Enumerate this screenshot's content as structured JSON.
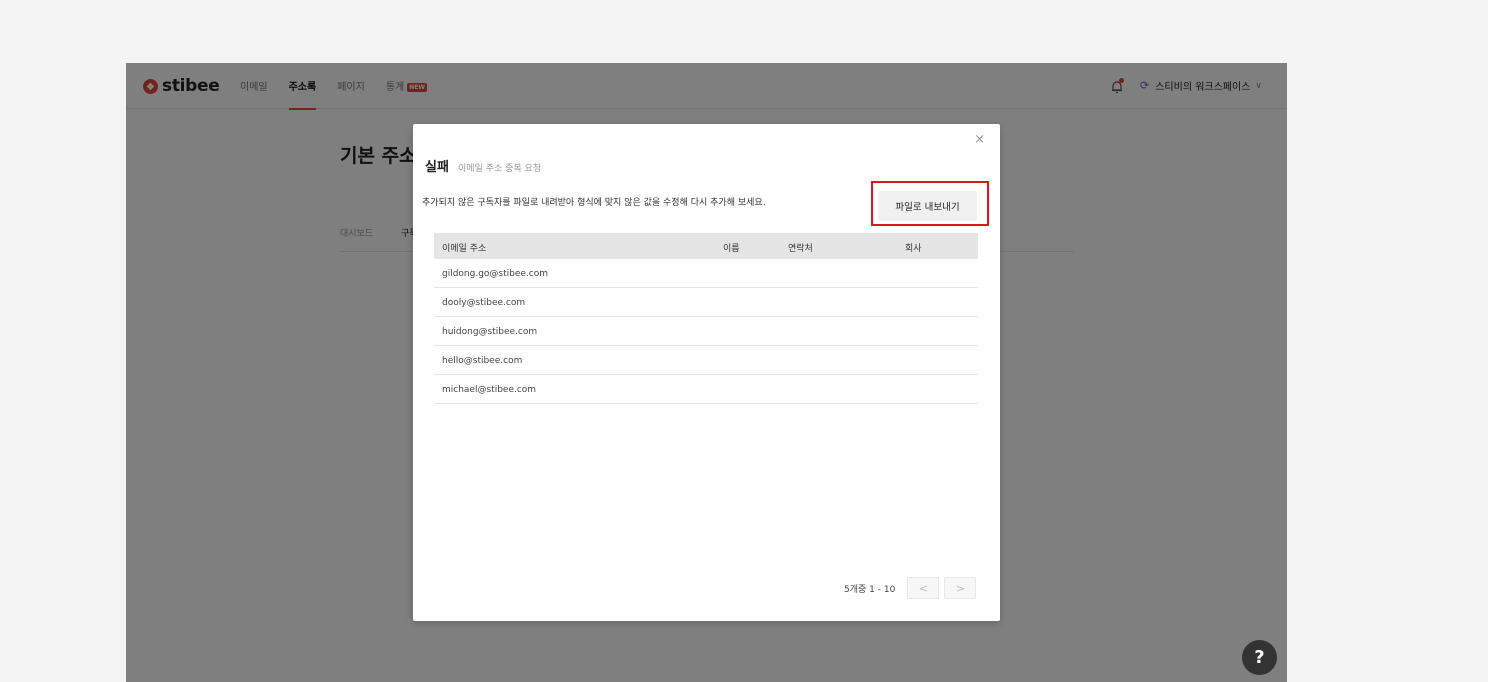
{
  "app": {
    "logo_text": "stibee",
    "nav": [
      {
        "label": "이메일"
      },
      {
        "label": "주소록"
      },
      {
        "label": "페이지"
      },
      {
        "label": "통계",
        "badge": "NEW"
      }
    ],
    "workspace_name": "스티비의 워크스페이스",
    "help_label": "?"
  },
  "page": {
    "title": "기본 주소록",
    "tabs": [
      "대시보드",
      "구독자"
    ]
  },
  "modal": {
    "title": "실패",
    "subtitle": "이메일 주소 중복 요청",
    "description": "추가되지 않은 구독자를 파일로 내려받아 형식에 맞지 않은 값을 수정해 다시 추가해 보세요.",
    "export_button": "파일로 내보내기",
    "close_glyph": "×",
    "columns": [
      "이메일 주소",
      "이름",
      "연락처",
      "회사"
    ],
    "rows": [
      {
        "email": "gildong.go@stibee.com"
      },
      {
        "email": "dooly@stibee.com"
      },
      {
        "email": "huidong@stibee.com"
      },
      {
        "email": "hello@stibee.com"
      },
      {
        "email": "michael@stibee.com"
      }
    ],
    "pagination": {
      "info": "5개중 1 - 10",
      "prev": "<",
      "next": ">"
    }
  },
  "colors": {
    "accent": "#e2493b",
    "highlight": "#e0151c",
    "workspace_icon": "#3f6fd8"
  }
}
